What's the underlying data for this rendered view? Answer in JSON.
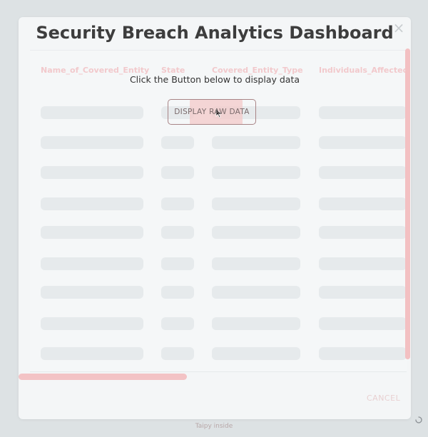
{
  "modal": {
    "title": "Security Breach Analytics Dashboard",
    "close_icon": "×",
    "prompt": "Click the Button below to display data",
    "display_button_label": "DISPLAY RAW DATA",
    "cancel_label": "CANCEL"
  },
  "table": {
    "columns": [
      "Name_of_Covered_Entity",
      "State",
      "Covered_Entity_Type",
      "Individuals_Affected"
    ]
  },
  "footer": {
    "text": "Taipy inside"
  },
  "colors": {
    "accent": "#f3c0c2",
    "title": "#3d3d3d",
    "button_border": "#a88486"
  }
}
